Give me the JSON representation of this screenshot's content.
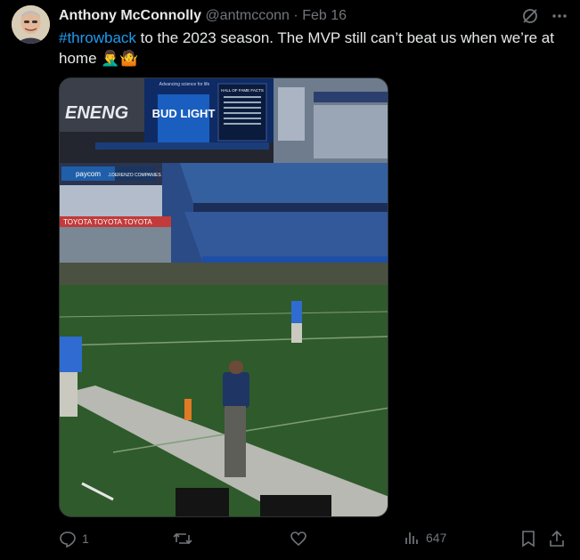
{
  "author": {
    "name": "Anthony McConnolly",
    "handle": "@antmcconn",
    "separator": "·",
    "date": "Feb 16"
  },
  "post": {
    "hashtag": "#throwback",
    "text": " to the 2023 season. The MVP still can’t beat us when we’re at home 🤦‍♂️🤷"
  },
  "media": {
    "scoreboard_ad": "BUD LIGHT",
    "scoreboard_tag": "Advancing science for life",
    "facts_title": "HALL OF FAME FACTS",
    "sponsor_1": "paycom",
    "sponsor_2": "J.DERENZO COMPANIES",
    "banner": "TOYOTA TOYOTA TOYOTA"
  },
  "actions": {
    "replies": "1",
    "reposts": "",
    "likes": "",
    "views": "647"
  },
  "colors": {
    "background": "#000000",
    "text": "#e7e9ea",
    "muted": "#71767b",
    "link": "#1d9bf0"
  }
}
